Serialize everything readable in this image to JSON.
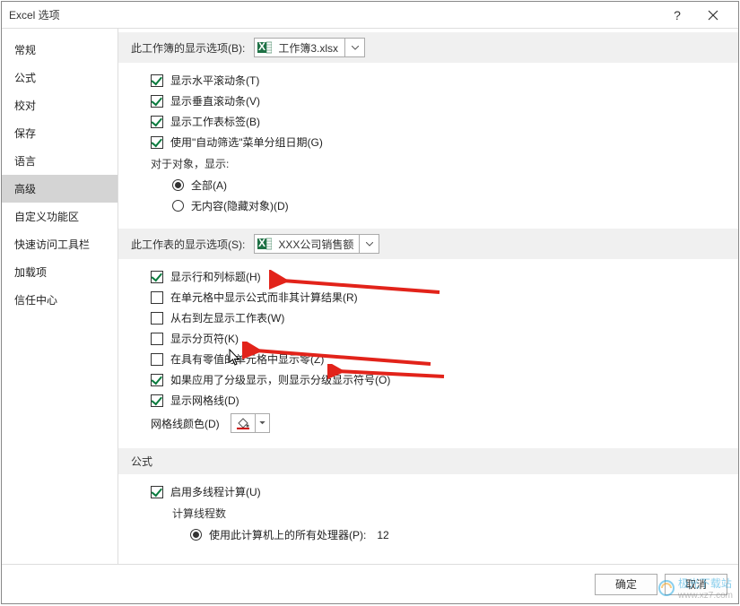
{
  "title": "Excel 选项",
  "sidebar": {
    "items": [
      {
        "label": "常规"
      },
      {
        "label": "公式"
      },
      {
        "label": "校对"
      },
      {
        "label": "保存"
      },
      {
        "label": "语言"
      },
      {
        "label": "高级"
      },
      {
        "label": "自定义功能区"
      },
      {
        "label": "快速访问工具栏"
      },
      {
        "label": "加载项"
      },
      {
        "label": "信任中心"
      }
    ],
    "selected_index": 5
  },
  "section_workbook": {
    "label": "此工作簿的显示选项(B):",
    "dropdown_value": "工作簿3.xlsx",
    "options": {
      "hscroll": "显示水平滚动条(T)",
      "vscroll": "显示垂直滚动条(V)",
      "tabs": "显示工作表标签(B)",
      "autofilter_date": "使用\"自动筛选\"菜单分组日期(G)"
    },
    "objects_label": "对于对象，显示:",
    "objects_all": "全部(A)",
    "objects_none": "无内容(隐藏对象)(D)"
  },
  "section_sheet": {
    "label": "此工作表的显示选项(S):",
    "dropdown_value": "XXX公司销售额",
    "options": {
      "row_col_headers": "显示行和列标题(H)",
      "formulas_not_results": "在单元格中显示公式而非其计算结果(R)",
      "rtl": "从右到左显示工作表(W)",
      "page_breaks": "显示分页符(K)",
      "show_zero": "在具有零值的单元格中显示零(Z)",
      "outline_symbols": "如果应用了分级显示，则显示分级显示符号(O)",
      "gridlines": "显示网格线(D)"
    },
    "gridline_color_label": "网格线颜色(D)"
  },
  "section_formula": {
    "label": "公式",
    "multithread": "启用多线程计算(U)",
    "thread_count_label": "计算线程数",
    "use_all_processors": "使用此计算机上的所有处理器(P):",
    "processor_count": "12"
  },
  "footer": {
    "ok": "确定",
    "cancel": "取消"
  },
  "watermark": {
    "brand": "极光下载站",
    "url": "www.xz7.com"
  }
}
